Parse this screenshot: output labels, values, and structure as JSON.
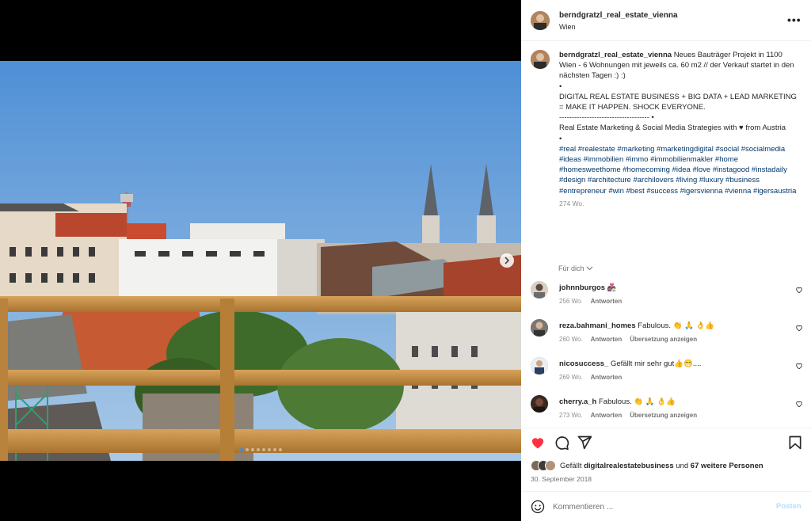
{
  "post": {
    "username": "berndgratzl_real_estate_vienna",
    "location": "Wien",
    "more_label": "•••"
  },
  "media": {
    "carousel_total": 8,
    "carousel_active": 1
  },
  "caption": {
    "username": "berndgratzl_real_estate_vienna",
    "line1": "Neues Bauträger Projekt in 1100 Wien - 6 Wohnungen mit jeweils ca. 60 m2 // der Verkauf startet in den nächsten Tagen :) :)",
    "bullet1": "•",
    "line2": "DIGITAL REAL ESTATE BUSINESS + BIG DATA + LEAD MARKETING = MAKE IT HAPPEN. SHOCK EVERYONE.",
    "divider": "------------------------------------ •",
    "line3": "Real Estate Marketing & Social Media Strategies with ♥ from Austria",
    "bullet2": "•",
    "tags1": "#real #realestate #marketing #marketingdigital #social #socialmedia",
    "tags2": "#ideas #immobilien #immo #immobilienmakler #home #homesweethome #homecoming #idea #love #instagood #instadaily",
    "tags3": "#design #architecture #archilovers #living #luxury #business #entrepreneur #win #best #success #igersvienna #vienna #igersaustria",
    "time": "274 Wo."
  },
  "fuer_dich": "Für dich",
  "comments": [
    {
      "user": "johnnburgos",
      "text": "👩🏽‍❤️‍👨🏻",
      "time": "256 Wo.",
      "reply": "Antworten",
      "translate": ""
    },
    {
      "user": "reza.bahmani_homes",
      "text": "Fabulous. 👏 🙏 👌👍",
      "time": "260 Wo.",
      "reply": "Antworten",
      "translate": "Übersetzung anzeigen"
    },
    {
      "user": "nicosuccess_",
      "text": "Gefällt mir sehr gut👍😁....",
      "time": "269 Wo.",
      "reply": "Antworten",
      "translate": ""
    },
    {
      "user": "cherry.a_h",
      "text": "Fabulous. 👏 🙏 👌👍",
      "time": "273 Wo.",
      "reply": "Antworten",
      "translate": "Übersetzung anzeigen"
    }
  ],
  "likes": {
    "prefix": "Gefällt",
    "user": "digitalrealestatebusiness",
    "middle": "und",
    "others": "67 weitere Personen"
  },
  "date": "30. September 2018",
  "comment_box": {
    "placeholder": "Kommentieren ...",
    "post_label": "Posten"
  },
  "colors": {
    "like_red": "#ff3040",
    "link_blue": "#00376b",
    "post_disabled": "#b2dffc",
    "carousel_dot_active": "#2f8cff"
  },
  "icons": [
    "heart-icon",
    "comment-icon",
    "share-icon",
    "bookmark-icon",
    "emoji-icon",
    "more-icon",
    "chevron-right-icon",
    "chevron-down-icon"
  ]
}
